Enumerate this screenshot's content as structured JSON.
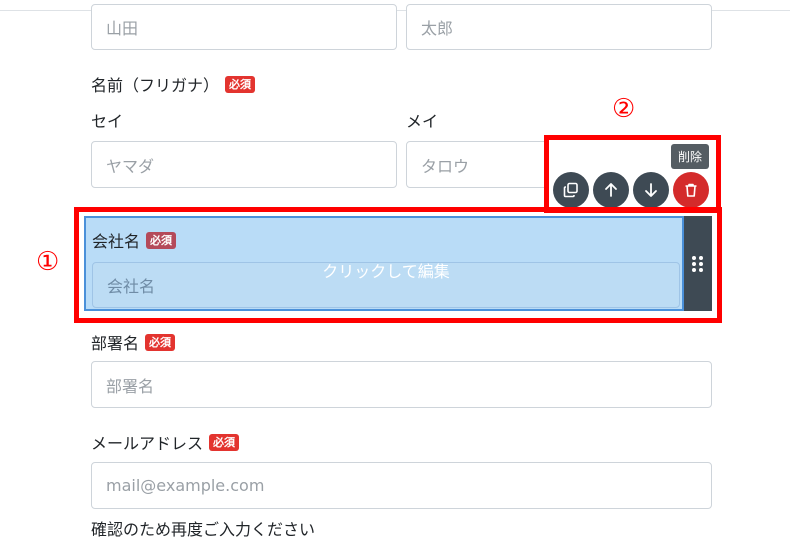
{
  "name_row": {
    "last_placeholder": "山田",
    "first_placeholder": "太郎"
  },
  "furigana": {
    "label": "名前（フリガナ）",
    "badge": "必須",
    "sei_label": "セイ",
    "mei_label": "メイ",
    "sei_placeholder": "ヤマダ",
    "mei_placeholder": "タロウ"
  },
  "company": {
    "label": "会社名",
    "badge": "必須",
    "placeholder": "会社名",
    "overlay_text": "クリックして編集"
  },
  "department": {
    "label": "部署名",
    "badge": "必須",
    "placeholder": "部署名"
  },
  "email": {
    "label": "メールアドレス",
    "badge": "必須",
    "placeholder": "mail@example.com"
  },
  "confirm": {
    "label": "確認のため再度ご入力ください"
  },
  "toolbar": {
    "tooltip": "削除",
    "icons": [
      "duplicate-icon",
      "arrow-up-icon",
      "arrow-down-icon",
      "trash-icon"
    ]
  },
  "annotations": {
    "marker_1": "①",
    "marker_2": "②"
  },
  "colors": {
    "highlight": "#ff0000",
    "selected_bg": "#b9dcf7",
    "badge": "#e3342f",
    "toolbar": "#3e4a54",
    "danger": "#d42b2b"
  }
}
